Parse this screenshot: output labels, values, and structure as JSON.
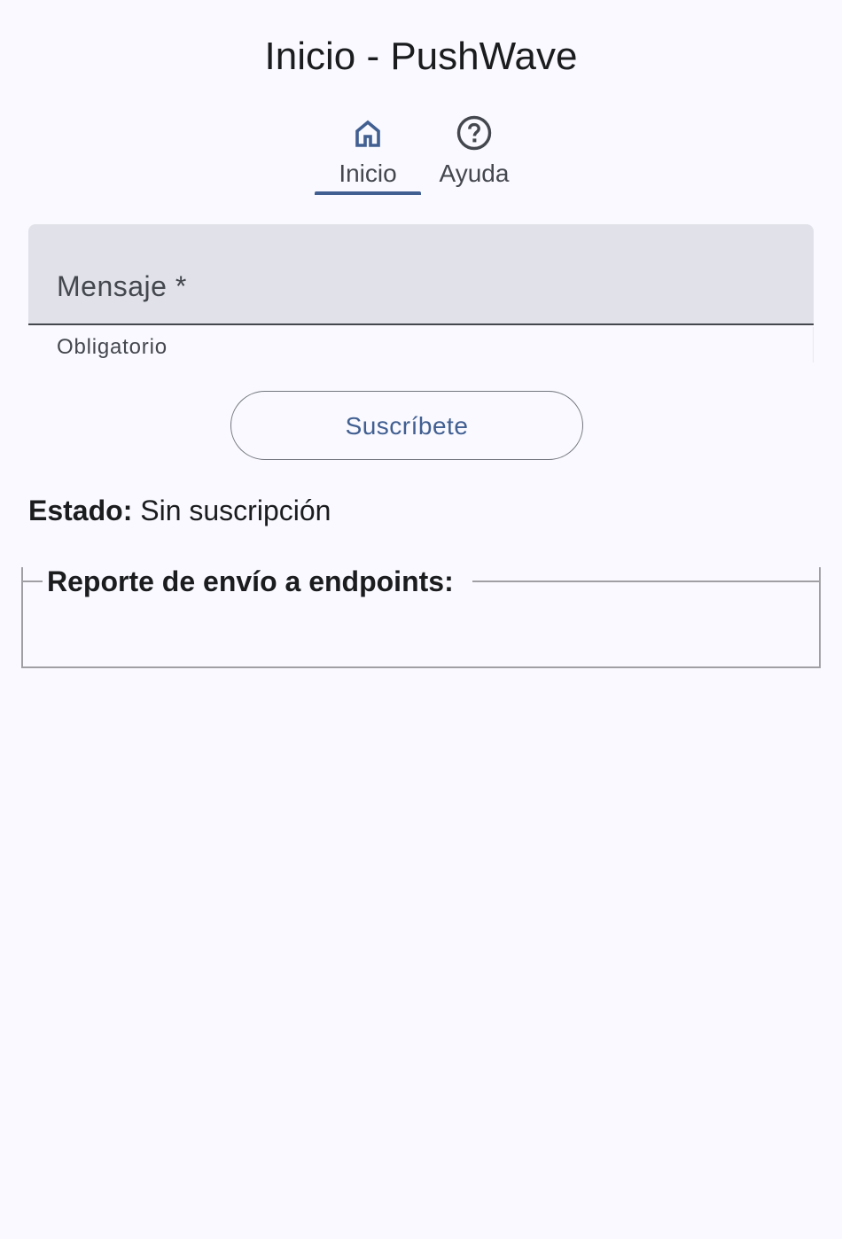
{
  "header": {
    "title": "Inicio - PushWave"
  },
  "tabs": [
    {
      "label": "Inicio",
      "icon": "home-icon",
      "selected": true
    },
    {
      "label": "Ayuda",
      "icon": "help-circle-icon",
      "selected": false
    }
  ],
  "form": {
    "message_label": "Mensaje *",
    "message_value": "",
    "message_support": "Obligatorio",
    "subscribe_label": "Suscríbete"
  },
  "status": {
    "label": "Estado:",
    "value": "Sin suscripción"
  },
  "report": {
    "legend": "Reporte de envío a endpoints:"
  },
  "colors": {
    "background": "#f9f9ff",
    "primary": "#415f91",
    "field_fill": "#e1e2e9",
    "on_surface": "#1a1c1e",
    "on_surface_variant": "#44474e",
    "outline": "#74777f"
  }
}
